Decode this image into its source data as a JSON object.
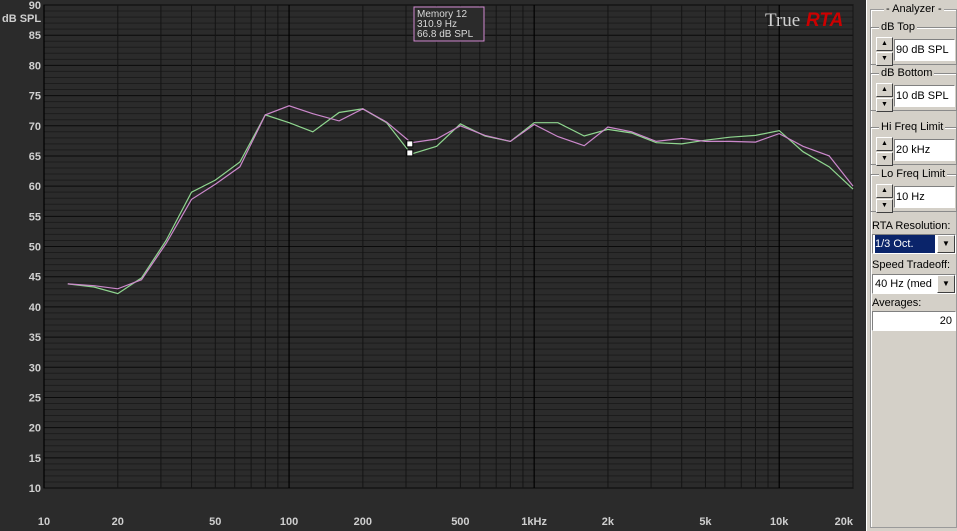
{
  "plot": {
    "background": "#2b2b2b",
    "y_axis_unit": "dB SPL",
    "y_ticks": [
      "90",
      "85",
      "80",
      "75",
      "70",
      "65",
      "60",
      "55",
      "50",
      "45",
      "40",
      "35",
      "30",
      "25",
      "20",
      "15",
      "10"
    ],
    "x_ticks": [
      "10",
      "20",
      "50",
      "100",
      "200",
      "500",
      "1kHz",
      "2k",
      "5k",
      "10k",
      "20k"
    ],
    "logo": {
      "part1": "True",
      "part2": "RTA",
      "color1": "#cfcfcf",
      "color2": "#cc0000"
    },
    "tooltip": {
      "line1": "Memory 12",
      "line2": "310.9 Hz",
      "line3": "66.8 dB SPL",
      "border_color": "#d28ad2"
    }
  },
  "chart_data": {
    "type": "line",
    "title": "",
    "xlabel": "",
    "ylabel": "dB SPL",
    "x_scale": "log",
    "xlim": [
      10,
      20000
    ],
    "ylim": [
      10,
      90
    ],
    "grid": true,
    "series": [
      {
        "color": "#8fd68f",
        "x": [
          12.5,
          16,
          20,
          25,
          31.5,
          40,
          50,
          63,
          80,
          100,
          125,
          160,
          200,
          250,
          315,
          400,
          500,
          630,
          800,
          1000,
          1250,
          1600,
          2000,
          2500,
          3150,
          4000,
          5000,
          6300,
          8000,
          10000,
          12500,
          16000,
          20000
        ],
        "y": [
          43.8,
          43.3,
          42.2,
          44.8,
          51.0,
          59.0,
          61.0,
          64.0,
          71.8,
          70.5,
          69.0,
          72.2,
          72.8,
          70.5,
          65.3,
          66.6,
          70.3,
          68.3,
          67.4,
          70.5,
          70.5,
          68.3,
          69.4,
          68.8,
          67.2,
          67.0,
          67.6,
          68.1,
          68.4,
          69.2,
          65.7,
          63.2,
          59.5
        ]
      },
      {
        "color": "#cc88cc",
        "x": [
          12.5,
          16,
          20,
          25,
          31.5,
          40,
          50,
          63,
          80,
          100,
          125,
          160,
          200,
          250,
          315,
          400,
          500,
          630,
          800,
          1000,
          1250,
          1600,
          2000,
          2500,
          3150,
          4000,
          5000,
          6300,
          8000,
          10000,
          12500,
          16000,
          20000
        ],
        "y": [
          43.8,
          43.5,
          43.0,
          44.5,
          50.5,
          57.8,
          60.3,
          63.2,
          71.8,
          73.3,
          72.0,
          70.8,
          72.8,
          70.6,
          67.2,
          67.8,
          70.0,
          68.4,
          67.4,
          70.2,
          68.2,
          66.7,
          69.8,
          69.0,
          67.4,
          67.9,
          67.4,
          67.4,
          67.3,
          68.7,
          66.6,
          65.0,
          60.0
        ]
      }
    ],
    "markers": [
      {
        "x": 310.9,
        "y": 67.0
      },
      {
        "x": 310.9,
        "y": 65.5
      }
    ]
  },
  "panel": {
    "title": "- Analyzer -",
    "db_top": {
      "label": "dB Top",
      "value": "90 dB SPL"
    },
    "db_bottom": {
      "label": "dB Bottom",
      "value": "10 dB SPL"
    },
    "hi_freq": {
      "label": "Hi Freq Limit",
      "value": "20 kHz"
    },
    "lo_freq": {
      "label": "Lo Freq Limit",
      "value": "10 Hz"
    },
    "rta_resolution": {
      "label": "RTA Resolution:",
      "value": "1/3 Oct."
    },
    "speed_tradeoff": {
      "label": "Speed Tradeoff:",
      "value": "40 Hz (med"
    },
    "averages": {
      "label": "Averages:",
      "value": "20"
    }
  }
}
